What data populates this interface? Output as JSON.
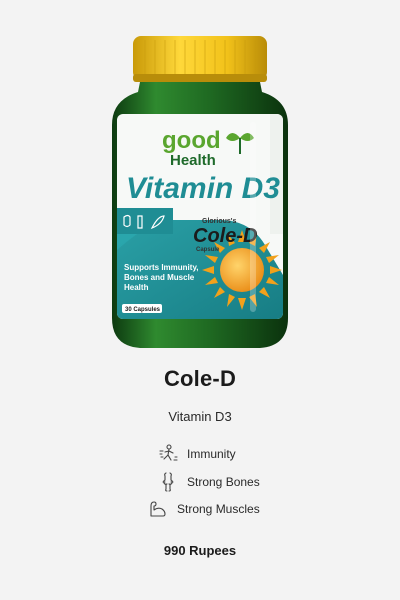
{
  "product": {
    "name": "Cole-D",
    "subtitle": "Vitamin D3",
    "price": "990 Rupees",
    "benefits": [
      {
        "label": "Immunity",
        "icon": "immunity-icon"
      },
      {
        "label": "Strong Bones",
        "icon": "bone-icon"
      },
      {
        "label": "Strong Muscles",
        "icon": "muscle-icon"
      }
    ]
  },
  "label": {
    "brand_top": "good",
    "brand_bottom": "Health",
    "headline": "Vitamin D3",
    "maker": "Glorious's",
    "product_name": "Cole-D",
    "form": "Capsule",
    "claim": "Supports Immunity, Bones and Muscle Health",
    "count": "30 Capsules"
  },
  "colors": {
    "bottle": "#1f6a22",
    "cap": "#f2c21a",
    "label_teal": "#1f8d94",
    "brand_green": "#5aa62f",
    "sun": "#f2a11b"
  }
}
